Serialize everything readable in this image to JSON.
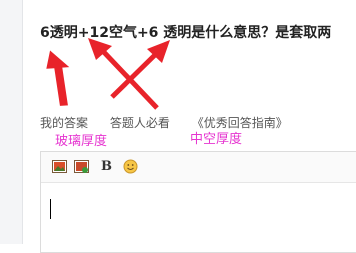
{
  "question": {
    "title": "6透明+12空气+6 透明是什么意思？是套取两"
  },
  "tabs": [
    {
      "label": "我的答案"
    },
    {
      "label": "答题人必看"
    },
    {
      "label": "《优秀回答指南》"
    }
  ],
  "annotations": {
    "glass_thickness": "玻璃厚度",
    "hollow_thickness": "中空厚度",
    "color": "#e635d0",
    "arrow_color": "#e8232a"
  },
  "editor": {
    "toolbar": {
      "bold_label": "B",
      "icons": [
        "image-icon",
        "picture-upload-icon",
        "bold-icon",
        "emoji-icon"
      ]
    }
  }
}
